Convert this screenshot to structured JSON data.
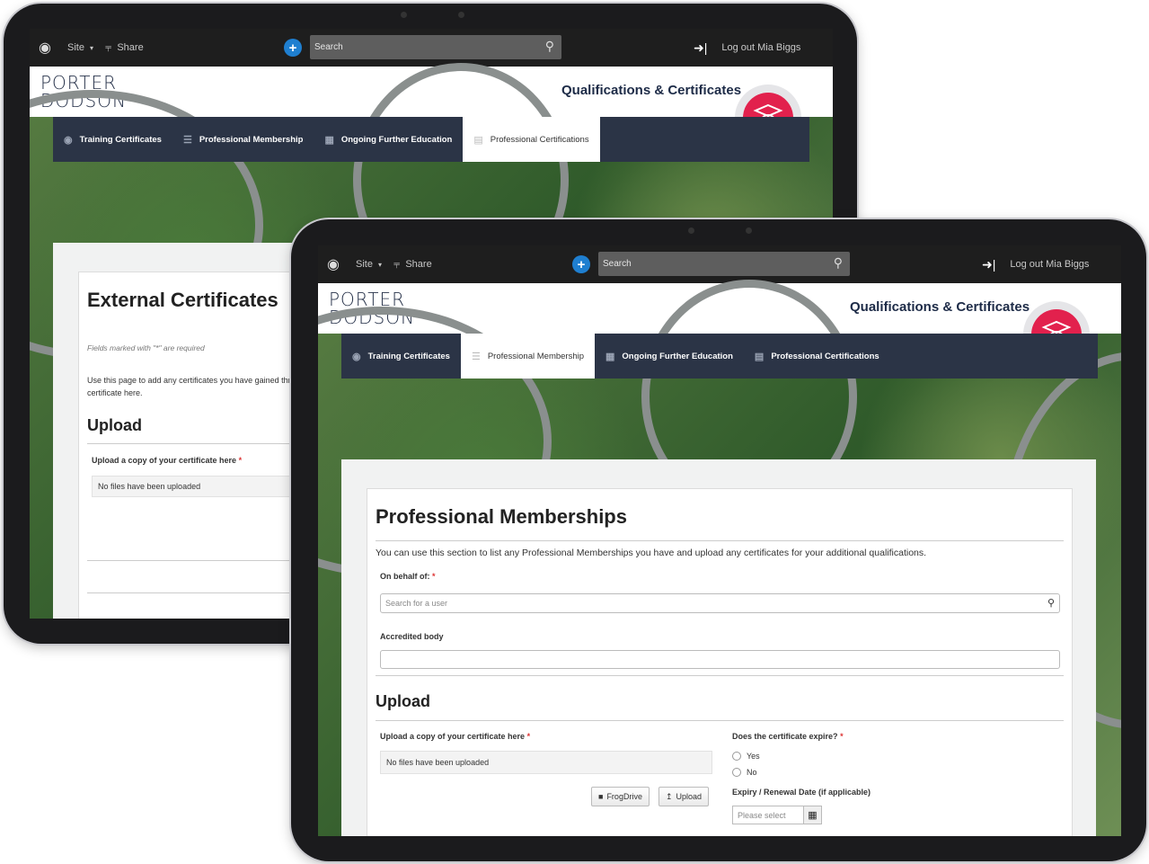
{
  "topbar": {
    "site_label": "Site",
    "share_label": "Share",
    "search_placeholder": "Search",
    "logout_label": "Log out Mia Biggs"
  },
  "header": {
    "logo_line1": "PORTER",
    "logo_line2": "DODSON",
    "app_title": "Qualifications & Certificates"
  },
  "tabs": [
    {
      "label": "Training Certificates"
    },
    {
      "label": "Professional Membership"
    },
    {
      "label": "Ongoing Further Education"
    },
    {
      "label": "Professional Certifications"
    }
  ],
  "back_screen": {
    "active_tab": "Professional Certifications",
    "title": "External Certificates",
    "required_note": "Fields marked with \"*\" are required",
    "intro": "Use this page to add any certificates you have gained thro",
    "intro_line2": "certificate here.",
    "upload_heading": "Upload",
    "upload_label": "Upload a copy of your certificate here",
    "no_files": "No files have been uploaded"
  },
  "front_screen": {
    "active_tab": "Professional Membership",
    "title": "Professional Memberships",
    "intro": "You can use this section to list any Professional Memberships you have and upload any certificates for your additional qualifications.",
    "on_behalf_label": "On behalf of:",
    "user_search_placeholder": "Search for a user",
    "accredited_label": "Accredited body",
    "accredited_value": "",
    "upload_heading": "Upload",
    "upload_label": "Upload a copy of your certificate here",
    "no_files": "No files have been uploaded",
    "frogdrive_label": "FrogDrive",
    "upload_button_label": "Upload",
    "expiry_question": "Does the certificate expire?",
    "yes_label": "Yes",
    "no_label": "No",
    "renewal_label": "Expiry / Renewal Date (if applicable)",
    "date_placeholder": "Please select"
  },
  "colors": {
    "accent_red": "#e2214d",
    "nav_bg": "#2b3446",
    "plus_blue": "#1f7fd0"
  }
}
